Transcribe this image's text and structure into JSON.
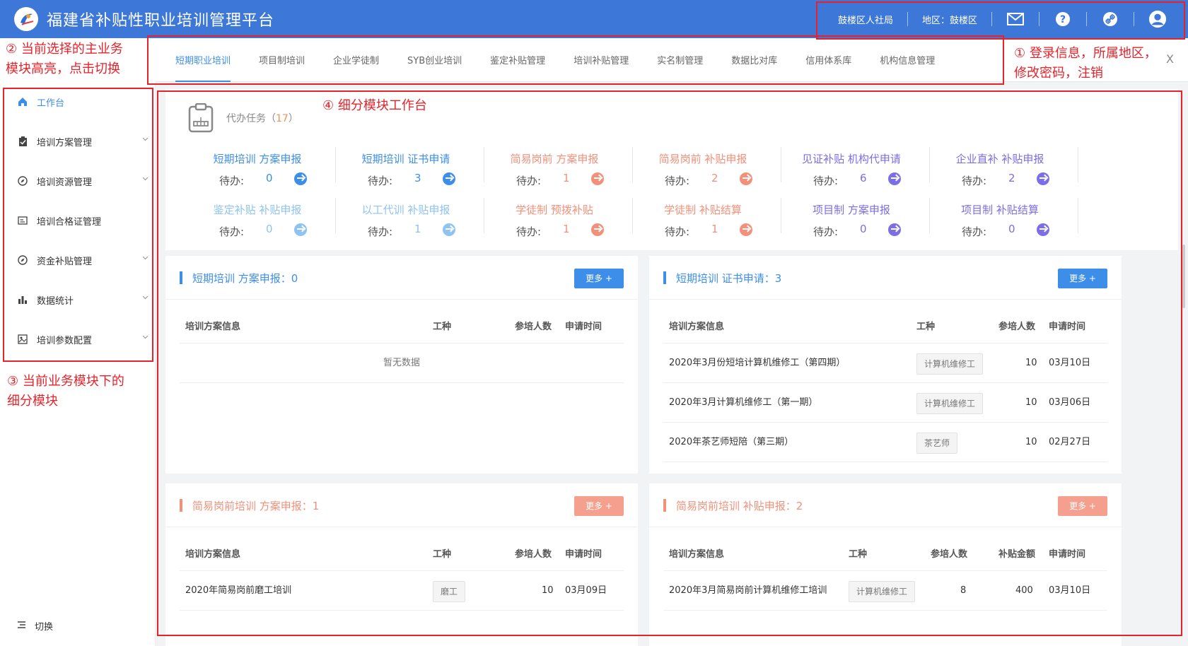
{
  "header": {
    "title": "福建省补贴性职业培训管理平台",
    "org": "鼓楼区人社局",
    "region": "地区：鼓楼区",
    "icons": [
      "mail-icon",
      "help-icon",
      "link-icon",
      "user-icon"
    ]
  },
  "main_tabs": [
    "短期职业培训",
    "项目制培训",
    "企业学徒制",
    "SYB创业培训",
    "鉴定补贴管理",
    "培训补贴管理",
    "实名制管理",
    "数据比对库",
    "信用体系库",
    "机构信息管理"
  ],
  "sidebar": {
    "items": [
      {
        "label": "工作台",
        "icon": "home-icon"
      },
      {
        "label": "培训方案管理",
        "icon": "clipboard-icon"
      },
      {
        "label": "培训资源管理",
        "icon": "compass-icon"
      },
      {
        "label": "培训合格证管理",
        "icon": "card-icon"
      },
      {
        "label": "资金补贴管理",
        "icon": "compass-icon"
      },
      {
        "label": "数据统计",
        "icon": "bar-chart-icon"
      },
      {
        "label": "培训参数配置",
        "icon": "image-icon"
      }
    ],
    "switch_label": "切换"
  },
  "tasks": {
    "title": "代办任务（",
    "count": "17",
    "title_end": "）",
    "pending_label": "待办:",
    "row1": [
      {
        "name": "短期培训 方案申报",
        "value": "0",
        "color": "#3d8ee8"
      },
      {
        "name": "短期培训 证书申请",
        "value": "3",
        "color": "#3d8ee8"
      },
      {
        "name": "简易岗前 方案申报",
        "value": "1",
        "color": "#f39079"
      },
      {
        "name": "简易岗前 补贴申报",
        "value": "2",
        "color": "#f39079"
      },
      {
        "name": "见证补贴 机构代申请",
        "value": "6",
        "color": "#7b6ee6"
      },
      {
        "name": "企业直补 补贴申报",
        "value": "2",
        "color": "#7b6ee6"
      }
    ],
    "row2": [
      {
        "name": "鉴定补贴 补贴申报",
        "value": "0",
        "color": "#8ec3f2"
      },
      {
        "name": "以工代训 补贴申报",
        "value": "1",
        "color": "#8ec3f2"
      },
      {
        "name": "学徒制 预拨补贴",
        "value": "1",
        "color": "#f39079"
      },
      {
        "name": "学徒制 补贴结算",
        "value": "1",
        "color": "#f39079"
      },
      {
        "name": "项目制 方案申报",
        "value": "0",
        "color": "#7b6ee6"
      },
      {
        "name": "项目制 补贴结算",
        "value": "0",
        "color": "#7b6ee6"
      }
    ]
  },
  "panels": [
    {
      "title": "短期培训 方案申报：0",
      "color": "#3d8ee8",
      "more": "更多 +",
      "headers": [
        "培训方案信息",
        "工种",
        "参培人数",
        "申请时间"
      ],
      "empty": "暂无数据",
      "rows": []
    },
    {
      "title": "短期培训 证书申请：3",
      "color": "#3d8ee8",
      "more": "更多 +",
      "headers": [
        "培训方案信息",
        "工种",
        "参培人数",
        "申请时间"
      ],
      "rows": [
        {
          "info": "2020年3月份短培计算机维修工（第四期）",
          "job": "计算机维修工",
          "count": "10",
          "date": "03月10日"
        },
        {
          "info": "2020年3月计算机维修工（第一期）",
          "job": "计算机维修工",
          "count": "10",
          "date": "03月06日"
        },
        {
          "info": "2020年茶艺师短陪（第三期）",
          "job": "茶艺师",
          "count": "10",
          "date": "02月27日"
        }
      ]
    },
    {
      "title": "简易岗前培训 方案申报：1",
      "color": "#f39079",
      "more": "更多 +",
      "headers": [
        "培训方案信息",
        "工种",
        "参培人数",
        "申请时间"
      ],
      "rows": [
        {
          "info": "2020年简易岗前磨工培训",
          "job": "磨工",
          "count": "10",
          "date": "03月09日"
        }
      ]
    },
    {
      "title": "简易岗前培训 补贴申报：2",
      "color": "#f39079",
      "more": "更多 +",
      "headers": [
        "培训方案信息",
        "工种",
        "参培人数",
        "补贴金额",
        "申请时间"
      ],
      "rows": [
        {
          "info": "2020年3月简易岗前计算机维修工培训",
          "job": "计算机维修工",
          "count": "8",
          "amount": "400",
          "date": "03月10日"
        }
      ]
    }
  ],
  "annotations": {
    "a1": "① 登录信息，所属地区，",
    "a1b": "修改密码，注销",
    "a2": "② 当前选择的主业务",
    "a2b": "模块高亮，点击切换",
    "a3": "③ 当前业务模块下的",
    "a3b": "细分模块",
    "a4": "④ 细分模块工作台"
  },
  "tab_close": "X"
}
